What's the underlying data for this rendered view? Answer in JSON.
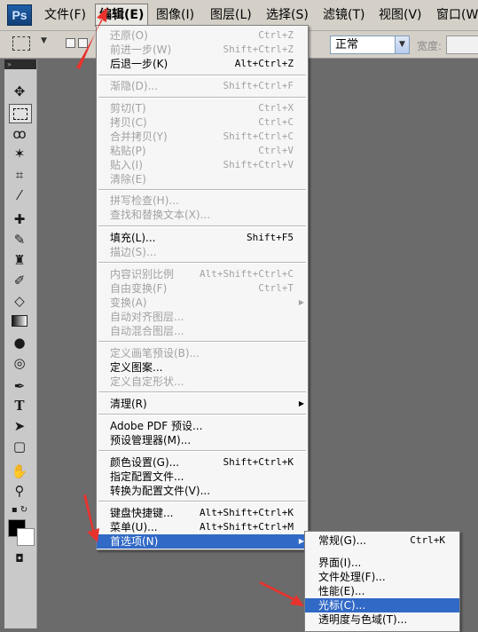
{
  "menubar": {
    "logo": "Ps",
    "items": [
      "文件(F)",
      "编辑(E)",
      "图像(I)",
      "图层(L)",
      "选择(S)",
      "滤镜(T)",
      "视图(V)",
      "窗口(W)"
    ]
  },
  "options_bar": {
    "mode_value": "正常",
    "width_label": "宽度:"
  },
  "edit_menu": {
    "items": [
      {
        "label": "还原(O)",
        "shortcut": "Ctrl+Z",
        "enabled": false
      },
      {
        "label": "前进一步(W)",
        "shortcut": "Shift+Ctrl+Z",
        "enabled": false
      },
      {
        "label": "后退一步(K)",
        "shortcut": "Alt+Ctrl+Z",
        "enabled": true
      },
      {
        "label": "渐隐(D)...",
        "shortcut": "Shift+Ctrl+F",
        "enabled": false
      },
      {
        "label": "剪切(T)",
        "shortcut": "Ctrl+X",
        "enabled": false
      },
      {
        "label": "拷贝(C)",
        "shortcut": "Ctrl+C",
        "enabled": false
      },
      {
        "label": "合并拷贝(Y)",
        "shortcut": "Shift+Ctrl+C",
        "enabled": false
      },
      {
        "label": "粘贴(P)",
        "shortcut": "Ctrl+V",
        "enabled": false
      },
      {
        "label": "贴入(I)",
        "shortcut": "Shift+Ctrl+V",
        "enabled": false
      },
      {
        "label": "清除(E)",
        "shortcut": "",
        "enabled": false
      },
      {
        "label": "拼写检查(H)...",
        "shortcut": "",
        "enabled": false
      },
      {
        "label": "查找和替换文本(X)...",
        "shortcut": "",
        "enabled": false
      },
      {
        "label": "填充(L)...",
        "shortcut": "Shift+F5",
        "enabled": true
      },
      {
        "label": "描边(S)...",
        "shortcut": "",
        "enabled": false
      },
      {
        "label": "内容识别比例",
        "shortcut": "Alt+Shift+Ctrl+C",
        "enabled": false
      },
      {
        "label": "自由变换(F)",
        "shortcut": "Ctrl+T",
        "enabled": false
      },
      {
        "label": "变换(A)",
        "shortcut": "",
        "enabled": false
      },
      {
        "label": "自动对齐图层...",
        "shortcut": "",
        "enabled": false
      },
      {
        "label": "自动混合图层...",
        "shortcut": "",
        "enabled": false
      },
      {
        "label": "定义画笔预设(B)...",
        "shortcut": "",
        "enabled": false
      },
      {
        "label": "定义图案...",
        "shortcut": "",
        "enabled": true
      },
      {
        "label": "定义自定形状...",
        "shortcut": "",
        "enabled": false
      },
      {
        "label": "清理(R)",
        "shortcut": "",
        "enabled": true
      },
      {
        "label": "Adobe PDF 预设...",
        "shortcut": "",
        "enabled": true
      },
      {
        "label": "预设管理器(M)...",
        "shortcut": "",
        "enabled": true
      },
      {
        "label": "颜色设置(G)...",
        "shortcut": "Shift+Ctrl+K",
        "enabled": true
      },
      {
        "label": "指定配置文件...",
        "shortcut": "",
        "enabled": true
      },
      {
        "label": "转换为配置文件(V)...",
        "shortcut": "",
        "enabled": true
      },
      {
        "label": "键盘快捷键...",
        "shortcut": "Alt+Shift+Ctrl+K",
        "enabled": true
      },
      {
        "label": "菜单(U)...",
        "shortcut": "Alt+Shift+Ctrl+M",
        "enabled": true
      },
      {
        "label": "首选项(N)",
        "shortcut": "",
        "enabled": true
      }
    ]
  },
  "preferences_submenu": {
    "items": [
      {
        "label": "常规(G)...",
        "shortcut": "Ctrl+K"
      },
      {
        "label": "界面(I)...",
        "shortcut": ""
      },
      {
        "label": "文件处理(F)...",
        "shortcut": ""
      },
      {
        "label": "性能(E)...",
        "shortcut": ""
      },
      {
        "label": "光标(C)...",
        "shortcut": ""
      },
      {
        "label": "透明度与色域(T)...",
        "shortcut": ""
      }
    ]
  },
  "colors": {
    "highlight": "#3169c6",
    "annotation_arrow": "#e8322d"
  },
  "tools": [
    "move-tool-icon",
    "marquee-tool-icon",
    "lasso-tool-icon",
    "magic-wand-tool-icon",
    "crop-tool-icon",
    "eyedropper-tool-icon",
    "healing-brush-tool-icon",
    "brush-tool-icon",
    "clone-stamp-tool-icon",
    "history-brush-tool-icon",
    "eraser-tool-icon",
    "gradient-tool-icon",
    "blur-tool-icon",
    "dodge-tool-icon",
    "pen-tool-icon",
    "type-tool-icon",
    "path-selection-tool-icon",
    "shape-tool-icon",
    "hand-tool-icon",
    "zoom-tool-icon"
  ]
}
